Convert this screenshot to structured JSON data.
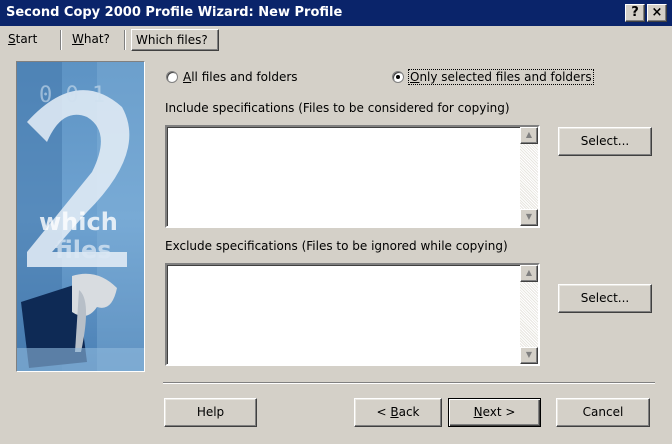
{
  "window": {
    "title": "Second Copy 2000 Profile Wizard: New Profile",
    "help_glyph": "?",
    "close_glyph": "×"
  },
  "tabs": [
    {
      "label": "Start",
      "accel": "S",
      "rest": "tart",
      "active": false
    },
    {
      "label": "What?",
      "accel": "W",
      "rest": "hat?",
      "active": false
    },
    {
      "label": "Which files?",
      "accel": "",
      "rest": "Which files?",
      "active": true
    }
  ],
  "side_image": {
    "big_numeral": "2",
    "caption_line1": "which",
    "caption_line2": "files"
  },
  "scope": {
    "all_label_pre": "A",
    "all_label_rest": "ll files and folders",
    "all_checked": false,
    "only_label_pre": "O",
    "only_label_rest": "nly selected files and folders",
    "only_checked": true
  },
  "include": {
    "label": "Include specifications (Files to be considered for copying)",
    "items": [],
    "select_button": "Select..."
  },
  "exclude": {
    "label": "Exclude specifications (Files to be ignored while copying)",
    "items": [],
    "select_button": "Select..."
  },
  "buttons": {
    "help": "Help",
    "back_accel": "B",
    "back_rest": "ack",
    "back_prefix": "< ",
    "next_accel": "N",
    "next_rest": "ext >",
    "cancel": "Cancel"
  },
  "icons": {
    "scroll_up": "up-arrow-icon",
    "scroll_down": "down-arrow-icon",
    "close": "close-icon",
    "help": "help-icon"
  }
}
